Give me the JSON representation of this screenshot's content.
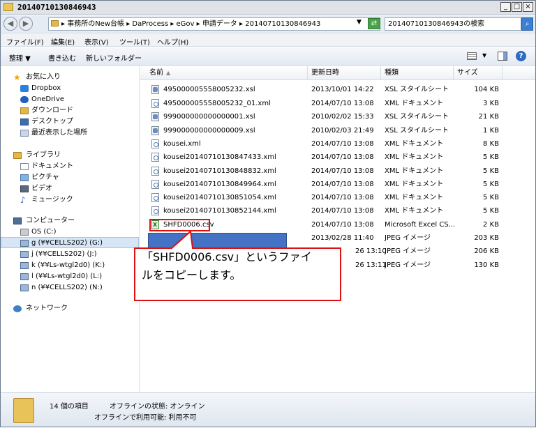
{
  "window": {
    "title": "20140710130846943",
    "min_label": "_",
    "max_label": "□",
    "close_label": "×"
  },
  "address": {
    "back": "◀",
    "forward": "▶",
    "breadcrumb": "▸ 事務所のNew台帳 ▸ DaProcess ▸ eGov ▸ 申請データ ▸ 20140710130846943",
    "dropdown": "▼",
    "refresh": "⇄",
    "search_placeholder": "20140710130846943の検索",
    "search_icon": "⌕"
  },
  "menu": [
    "ファイル(F)",
    "編集(E)",
    "表示(V)",
    "ツール(T)",
    "ヘルプ(H)"
  ],
  "toolbar": {
    "organize": "整理 ▼",
    "burn": "書き込む",
    "new_folder": "新しいフォルダー",
    "view_dropdown": "▼",
    "help": "?"
  },
  "nav": {
    "favorites": [
      "お気に入り",
      "Dropbox",
      "OneDrive",
      "ダウンロード",
      "デスクトップ",
      "最近表示した場所"
    ],
    "libraries": [
      "ライブラリ",
      "ドキュメント",
      "ピクチャ",
      "ビデオ",
      "ミュージック"
    ],
    "computer": [
      "コンピューター",
      "OS (C:)",
      "g (¥¥CELLS202) (G:)",
      "j (¥¥CELLS202) (J:)",
      "k (¥¥Ls-wtgl2d0) (K:)",
      "l (¥¥Ls-wtgl2d0) (L:)",
      "n (¥¥CELLS202) (N:)"
    ],
    "network": "ネットワーク"
  },
  "columns": {
    "name": "名前",
    "sort": "▲",
    "date": "更新日時",
    "type": "種類",
    "size": "サイズ"
  },
  "files": [
    {
      "name": "495000005558005232.xsl",
      "date": "2013/10/01 14:22",
      "type": "XSL スタイルシート",
      "size": "104 KB",
      "icon": "xsl"
    },
    {
      "name": "495000005558005232_01.xml",
      "date": "2014/07/10 13:08",
      "type": "XML ドキュメント",
      "size": "3 KB",
      "icon": "xml"
    },
    {
      "name": "999000000000000001.xsl",
      "date": "2010/02/02 15:33",
      "type": "XSL スタイルシート",
      "size": "21 KB",
      "icon": "xsl"
    },
    {
      "name": "999000000000000009.xsl",
      "date": "2010/02/03 21:49",
      "type": "XSL スタイルシート",
      "size": "1 KB",
      "icon": "xsl"
    },
    {
      "name": "kousei.xml",
      "date": "2014/07/10 13:08",
      "type": "XML ドキュメント",
      "size": "8 KB",
      "icon": "xml"
    },
    {
      "name": "kousei20140710130847433.xml",
      "date": "2014/07/10 13:08",
      "type": "XML ドキュメント",
      "size": "5 KB",
      "icon": "xml"
    },
    {
      "name": "kousei20140710130848832.xml",
      "date": "2014/07/10 13:08",
      "type": "XML ドキュメント",
      "size": "5 KB",
      "icon": "xml"
    },
    {
      "name": "kousei20140710130849964.xml",
      "date": "2014/07/10 13:08",
      "type": "XML ドキュメント",
      "size": "5 KB",
      "icon": "xml"
    },
    {
      "name": "kousei20140710130851054.xml",
      "date": "2014/07/10 13:08",
      "type": "XML ドキュメント",
      "size": "5 KB",
      "icon": "xml"
    },
    {
      "name": "kousei20140710130852144.xml",
      "date": "2014/07/10 13:08",
      "type": "XML ドキュメント",
      "size": "5 KB",
      "icon": "xml"
    },
    {
      "name": "SHFD0006.csv",
      "date": "2014/07/10 13:08",
      "type": "Microsoft Excel CS...",
      "size": "2 KB",
      "icon": "csv"
    },
    {
      "name": "",
      "date": "2013/02/28 11:40",
      "type": "JPEG イメージ",
      "size": "203 KB",
      "icon": "jpg"
    },
    {
      "name": "",
      "date": "26 13:10",
      "type": "JPEG イメージ",
      "size": "206 KB",
      "icon": "jpg"
    },
    {
      "name": "",
      "date": "26 13:11",
      "type": "JPEG イメージ",
      "size": "130 KB",
      "icon": "jpg"
    }
  ],
  "callout": {
    "line1": "「SHFD0006.csv」というファイ",
    "line2": "ルをコピーします。"
  },
  "status": {
    "count": "14 個の項目",
    "offline_status": "オフラインの状態: オンライン",
    "offline_availability": "オフラインで利用可能: 利用不可"
  },
  "colors": {
    "callout_border": "#e01010",
    "highlight": "#e01010",
    "blue_block": "#4472c4"
  }
}
